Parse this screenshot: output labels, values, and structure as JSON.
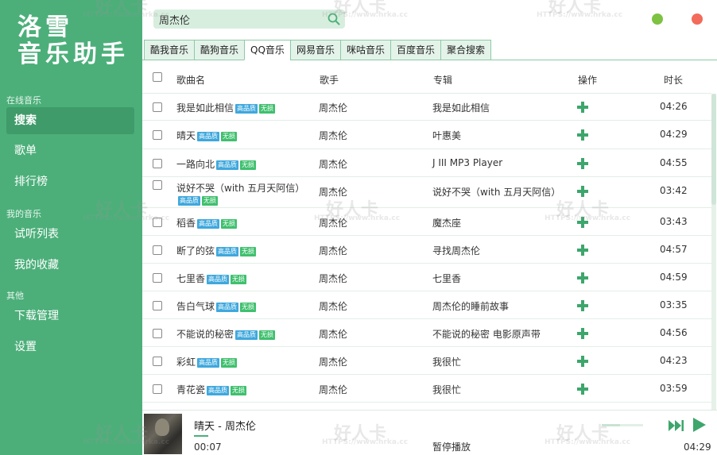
{
  "app": {
    "logo_line1": "洛雪",
    "logo_line2": "音乐助手"
  },
  "sidebar": {
    "groups": [
      {
        "label": "在线音乐",
        "items": [
          "搜索",
          "歌单",
          "排行榜"
        ]
      },
      {
        "label": "我的音乐",
        "items": [
          "试听列表",
          "我的收藏"
        ]
      },
      {
        "label": "其他",
        "items": [
          "下载管理",
          "设置"
        ]
      }
    ],
    "active_item": "搜索"
  },
  "search": {
    "value": "周杰伦"
  },
  "tabs": [
    "酷我音乐",
    "酷狗音乐",
    "QQ音乐",
    "网易音乐",
    "咪咕音乐",
    "百度音乐",
    "聚合搜索"
  ],
  "active_tab": "QQ音乐",
  "table": {
    "headers": {
      "name": "歌曲名",
      "artist": "歌手",
      "album": "专辑",
      "action": "操作",
      "duration": "时长"
    },
    "badge_hq": "高品质",
    "badge_lossless": "无损",
    "rows": [
      {
        "name": "我是如此相信",
        "artist": "周杰伦",
        "album": "我是如此相信",
        "duration": "04:26"
      },
      {
        "name": "晴天",
        "artist": "周杰伦",
        "album": "叶惠美",
        "duration": "04:29"
      },
      {
        "name": "一路向北",
        "artist": "周杰伦",
        "album": "J III MP3 Player",
        "duration": "04:55"
      },
      {
        "name": "说好不哭（with 五月天阿信）",
        "artist": "周杰伦",
        "album": "说好不哭（with 五月天阿信）",
        "duration": "03:42"
      },
      {
        "name": "稻香",
        "artist": "周杰伦",
        "album": "魔杰座",
        "duration": "03:43"
      },
      {
        "name": "断了的弦",
        "artist": "周杰伦",
        "album": "寻找周杰伦",
        "duration": "04:57"
      },
      {
        "name": "七里香",
        "artist": "周杰伦",
        "album": "七里香",
        "duration": "04:59"
      },
      {
        "name": "告白气球",
        "artist": "周杰伦",
        "album": "周杰伦的睡前故事",
        "duration": "03:35"
      },
      {
        "name": "不能说的秘密",
        "artist": "周杰伦",
        "album": "不能说的秘密 电影原声带",
        "duration": "04:56"
      },
      {
        "name": "彩虹",
        "artist": "周杰伦",
        "album": "我很忙",
        "duration": "04:23"
      },
      {
        "name": "青花瓷",
        "artist": "周杰伦",
        "album": "我很忙",
        "duration": "03:59"
      }
    ]
  },
  "player": {
    "now_playing": "晴天 - 周杰伦",
    "current_time": "00:07",
    "status": "暂停播放",
    "total_time": "04:29",
    "progress": 0.03,
    "volume": 0.45
  },
  "watermark": {
    "main": "好人卡",
    "url": "HTTPS://www.hrka.cc"
  },
  "colors": {
    "sidebar": "#4caf7a",
    "accent": "#3da66c",
    "badge_hq": "#3fa8dd",
    "badge_lossless": "#3fc06e",
    "window_minimize": "#7dc242",
    "window_close": "#f26b5b"
  }
}
